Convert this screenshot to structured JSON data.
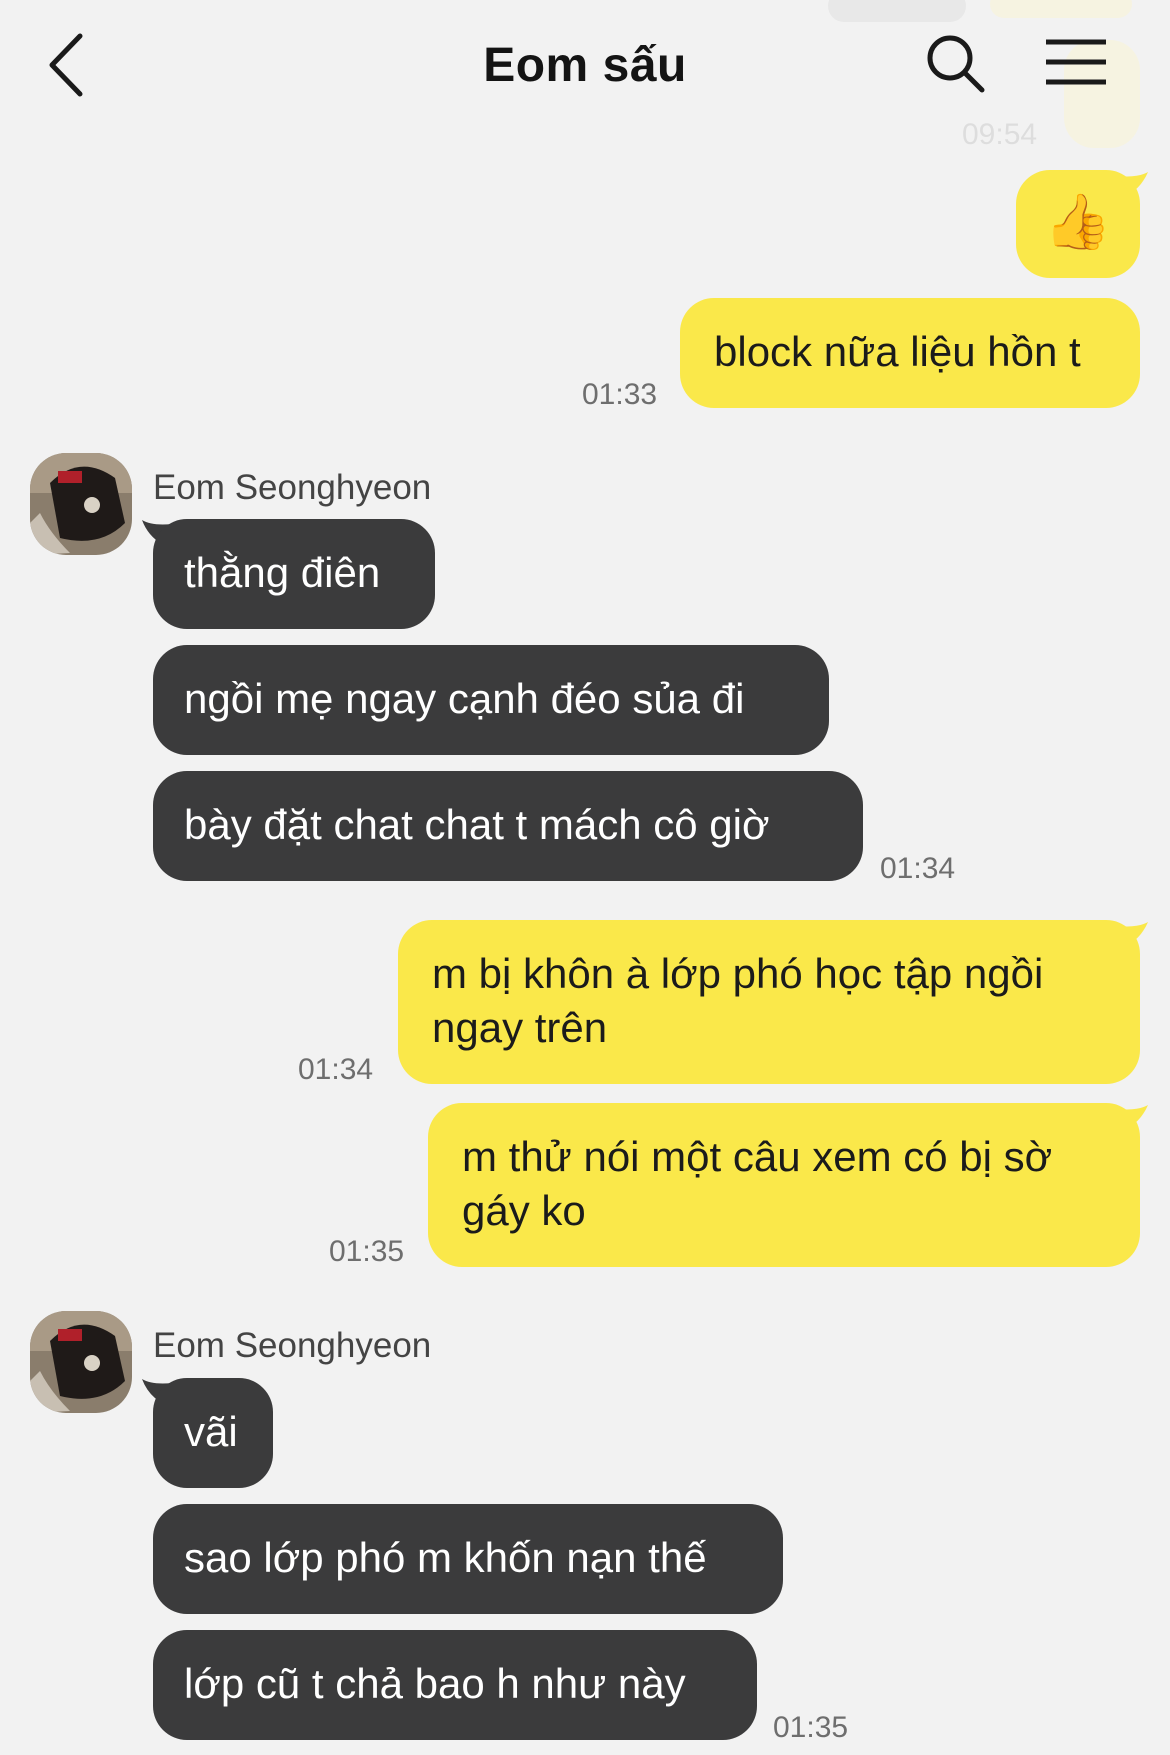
{
  "header": {
    "title": "Eom sấu",
    "back_icon": "chevron-left-icon",
    "search_icon": "search-icon",
    "menu_icon": "hamburger-menu-icon"
  },
  "colors": {
    "background": "#f2f2f2",
    "my_bubble": "#fae84a",
    "their_bubble": "#3b3b3c"
  },
  "top_faded": {
    "time": "09:54"
  },
  "messages": {
    "m1": {
      "emoji": "👍"
    },
    "m2": {
      "text": "block nữa liệu hồn t",
      "time": "01:33"
    },
    "group1": {
      "sender": "Eom Seonghyeon",
      "m1": "thằng điên",
      "m2": "ngồi mẹ ngay cạnh đéo sủa đi",
      "m3": "bày đặt chat chat t mách cô giờ",
      "time": "01:34"
    },
    "m3": {
      "line1": "m bị khôn à lớp phó học tập ngồi",
      "line2": "ngay trên",
      "time": "01:34"
    },
    "m4": {
      "line1": "m thử nói một câu xem có bị sờ",
      "line2": "gáy ko",
      "time": "01:35"
    },
    "group2": {
      "sender": "Eom Seonghyeon",
      "m1": "vãi",
      "m2": "sao lớp phó m khốn nạn thế",
      "m3": "lớp cũ t chả bao h như này",
      "time": "01:35"
    }
  }
}
